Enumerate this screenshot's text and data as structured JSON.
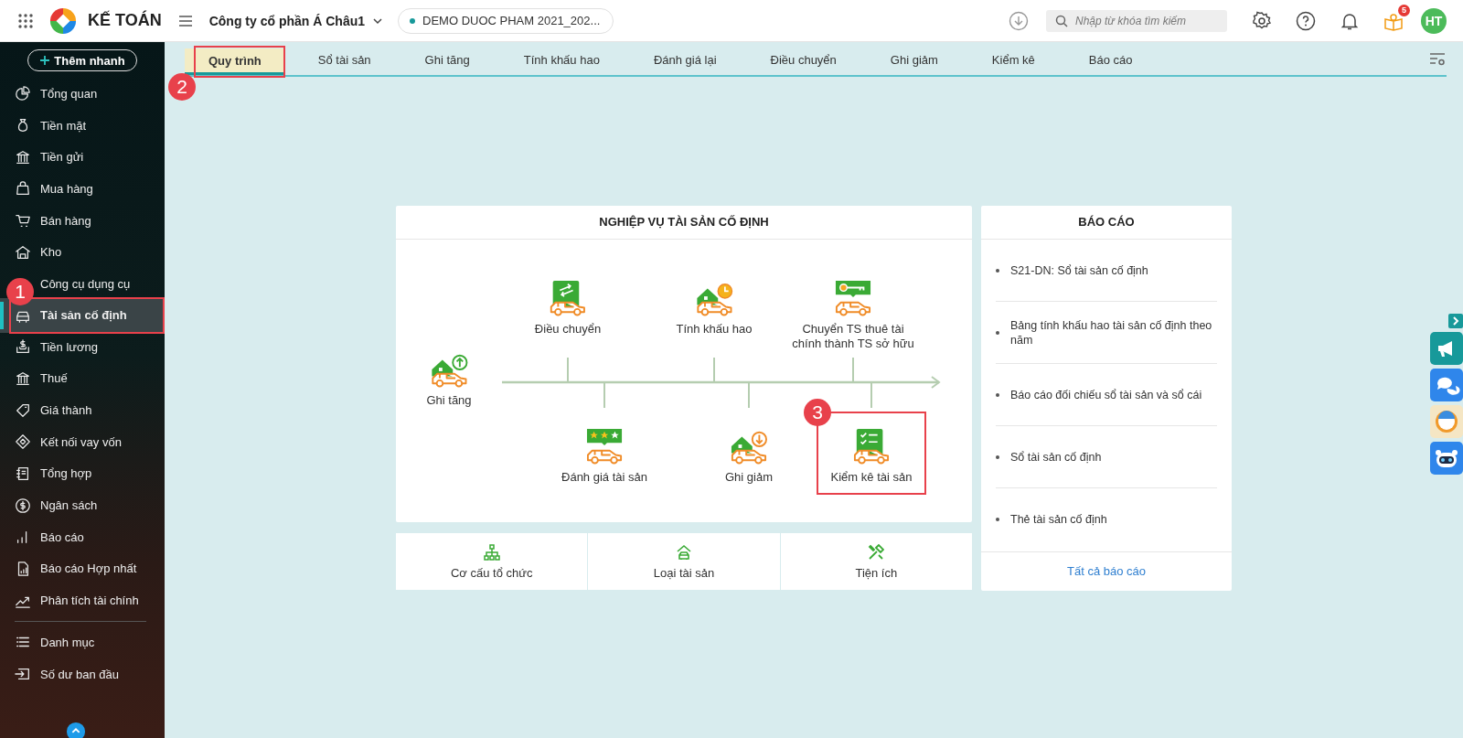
{
  "topbar": {
    "app_name": "KẾ TOÁN",
    "company": "Công ty cổ phần Á Châu1",
    "database": "DEMO DUOC PHAM 2021_202...",
    "search": {
      "placeholder": "Nhập từ khóa tìm kiếm"
    },
    "notification_count": "5",
    "avatar": "HT"
  },
  "sidebar": {
    "quick_add": "Thêm nhanh",
    "items": [
      {
        "label": "Tổng quan",
        "selected": false
      },
      {
        "label": "Tiền mặt",
        "selected": false
      },
      {
        "label": "Tiền gửi",
        "selected": false
      },
      {
        "label": "Mua hàng",
        "selected": false
      },
      {
        "label": "Bán hàng",
        "selected": false
      },
      {
        "label": "Kho",
        "selected": false
      },
      {
        "label": "Công cụ dụng cụ",
        "selected": false
      },
      {
        "label": "Tài sản cố định",
        "selected": true,
        "callout": "1"
      },
      {
        "label": "Tiền lương",
        "selected": false
      },
      {
        "label": "Thuế",
        "selected": false
      },
      {
        "label": "Giá thành",
        "selected": false
      },
      {
        "label": "Kết nối vay vốn",
        "selected": false
      },
      {
        "label": "Tổng hợp",
        "selected": false
      },
      {
        "label": "Ngân sách",
        "selected": false
      },
      {
        "label": "Báo cáo",
        "selected": false
      },
      {
        "label": "Báo cáo Hợp nhất",
        "selected": false
      },
      {
        "label": "Phân tích tài chính",
        "selected": false
      }
    ],
    "bottom_items": [
      {
        "label": "Danh mục",
        "selected": false
      },
      {
        "label": "Số dư ban đầu",
        "selected": false
      }
    ]
  },
  "tabs": [
    {
      "label": "Quy trình",
      "selected": true,
      "callout": "2"
    },
    {
      "label": "Sổ tài sản",
      "selected": false
    },
    {
      "label": "Ghi tăng",
      "selected": false
    },
    {
      "label": "Tính khấu hao",
      "selected": false
    },
    {
      "label": "Đánh giá lại",
      "selected": false
    },
    {
      "label": "Điều chuyển",
      "selected": false
    },
    {
      "label": "Ghi giảm",
      "selected": false
    },
    {
      "label": "Kiểm kê",
      "selected": false
    },
    {
      "label": "Báo cáo",
      "selected": false
    }
  ],
  "workflow": {
    "title": "NGHIỆP VỤ TÀI SẢN CỐ ĐỊNH",
    "steps": [
      {
        "label": "Ghi tăng"
      },
      {
        "label": "Điều chuyển"
      },
      {
        "label": "Tính khấu hao"
      },
      {
        "label": "Chuyển TS thuê tài chính thành TS sở hữu"
      },
      {
        "label": "Đánh giá tài sản"
      },
      {
        "label": "Ghi giảm"
      },
      {
        "label": "Kiểm kê tài sản",
        "callout": "3"
      }
    ]
  },
  "shortcuts": [
    {
      "label": "Cơ cấu tổ chức"
    },
    {
      "label": "Loại tài sản"
    },
    {
      "label": "Tiện ích"
    }
  ],
  "reports": {
    "title": "BÁO CÁO",
    "items": [
      "S21-DN: Sổ tài sản cố định",
      "Bảng tính khấu hao tài sản cố định theo năm",
      "Báo cáo đối chiếu sổ tài sản và sổ cái",
      "Sổ tài sản cố định",
      "Thẻ tài sản cố định"
    ],
    "all_link": "Tất cả báo cáo"
  }
}
